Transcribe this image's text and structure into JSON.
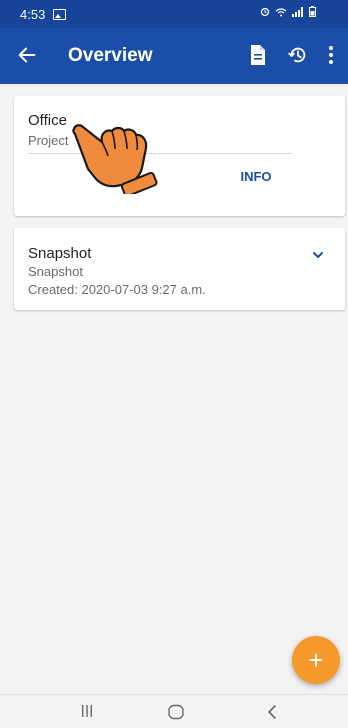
{
  "status": {
    "time": "4:53"
  },
  "appbar": {
    "title": "Overview"
  },
  "cards": [
    {
      "title": "Office",
      "subtitle": "Project",
      "action": "INFO"
    },
    {
      "title": "Snapshot",
      "subtitle": "Snapshot",
      "created": "Created: 2020-07-03 9:27 a.m."
    }
  ],
  "fab": {
    "label": "+"
  },
  "colors": {
    "appbar": "#1b4ea8",
    "statusbar": "#16459a",
    "accent": "#f79a2d",
    "background": "#f3f3f3"
  },
  "icons": [
    "back-arrow-icon",
    "document-icon",
    "history-icon",
    "more-vert-icon",
    "chevron-down-icon",
    "pointing-hand-icon"
  ]
}
